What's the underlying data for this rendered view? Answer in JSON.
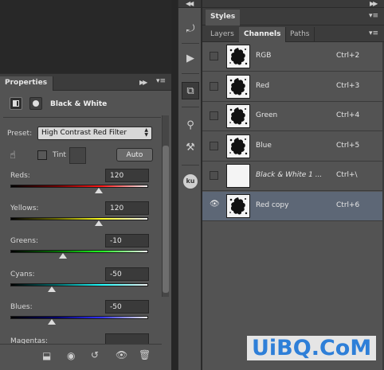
{
  "properties": {
    "tab": "Properties",
    "adjustment_title": "Black & White",
    "preset_label": "Preset:",
    "preset_value": "High Contrast Red Filter",
    "tint_label": "Tint",
    "auto_label": "Auto",
    "sliders": [
      {
        "label": "Reds:",
        "value": "120",
        "position": 0.64,
        "gradient": "linear-gradient(to right, #000, #6e0000, #ff1a1a, #f0f0f0)"
      },
      {
        "label": "Yellows:",
        "value": "120",
        "position": 0.64,
        "gradient": "linear-gradient(to right, #000, #6b6b00, #ffff22, #f0f0f0)"
      },
      {
        "label": "Greens:",
        "value": "-10",
        "position": 0.38,
        "gradient": "linear-gradient(to right, #000, #006b00, #22ff22, #f0f0f0)"
      },
      {
        "label": "Cyans:",
        "value": "-50",
        "position": 0.3,
        "gradient": "linear-gradient(to right, #000, #006b6b, #22ffff, #f0f0f0)"
      },
      {
        "label": "Blues:",
        "value": "-50",
        "position": 0.3,
        "gradient": "linear-gradient(to right, #000, #00006b, #3333ff, #f0f0f0)"
      }
    ],
    "partial_label": "Magentas:"
  },
  "styles_tab": "Styles",
  "channel_tabs": [
    "Layers",
    "Channels",
    "Paths"
  ],
  "channels": [
    {
      "name": "RGB",
      "shortcut": "Ctrl+2",
      "visible": false,
      "selected": false,
      "italic": false,
      "blank": false
    },
    {
      "name": "Red",
      "shortcut": "Ctrl+3",
      "visible": false,
      "selected": false,
      "italic": false,
      "blank": false
    },
    {
      "name": "Green",
      "shortcut": "Ctrl+4",
      "visible": false,
      "selected": false,
      "italic": false,
      "blank": false
    },
    {
      "name": "Blue",
      "shortcut": "Ctrl+5",
      "visible": false,
      "selected": false,
      "italic": false,
      "blank": false
    },
    {
      "name": "Black & White 1 ...",
      "shortcut": "Ctrl+\\",
      "visible": false,
      "selected": false,
      "italic": true,
      "blank": true
    },
    {
      "name": "Red copy",
      "shortcut": "Ctrl+6",
      "visible": true,
      "selected": true,
      "italic": false,
      "blank": false
    }
  ],
  "strip_label": "ku",
  "watermark": "UiBQ.CoM",
  "colors": {
    "selected_row": "#5d6776",
    "panel_bg": "#535353",
    "watermark": "#2e7fd8"
  }
}
